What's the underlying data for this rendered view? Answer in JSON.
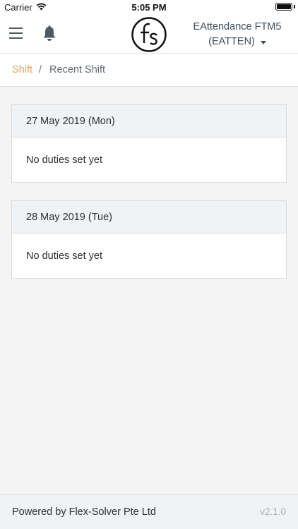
{
  "status_bar": {
    "carrier": "Carrier",
    "time": "5:05 PM",
    "battery_level": 1.0
  },
  "header": {
    "menu_icon": "hamburger-menu-icon",
    "bell_icon": "bell-icon",
    "logo_icon": "fs-logo",
    "org_name": "EAttendance FTM5",
    "org_code": "(EATTEN)",
    "colors": {
      "text": "#3c4f5c",
      "icon": "#4a5a66"
    }
  },
  "breadcrumb": {
    "parent": "Shift",
    "separator": "/",
    "current": "Recent Shift",
    "colors": {
      "link": "#d9a85b",
      "current": "#5d6b76"
    }
  },
  "days": [
    {
      "date": "27 May 2019 (Mon)",
      "message": "No duties set yet"
    },
    {
      "date": "28 May 2019 (Tue)",
      "message": "No duties set yet"
    }
  ],
  "footer": {
    "powered_by": "Powered by Flex-Solver Pte Ltd",
    "version": "v2.1.0"
  }
}
